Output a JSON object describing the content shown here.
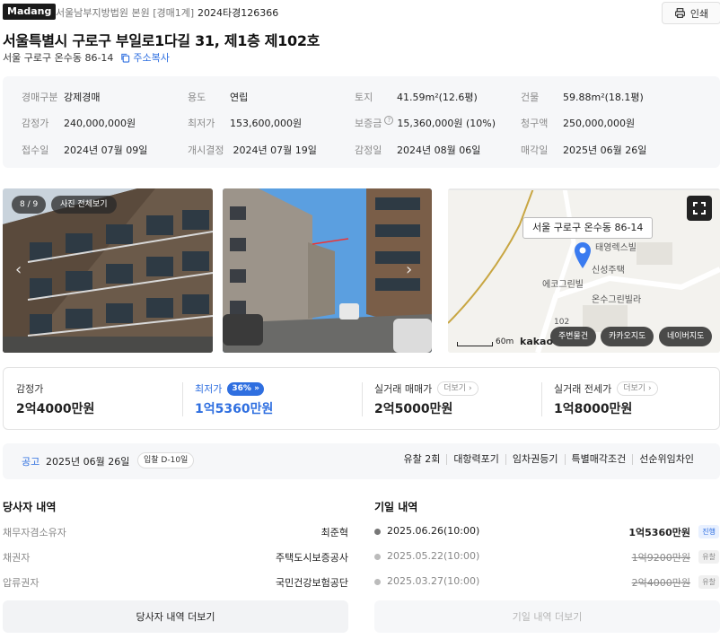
{
  "header": {
    "logo": "Madang",
    "court": "서울남부지방법원 본원 [경매1계]",
    "case_no": "2024타경126366",
    "print_label": "인쇄"
  },
  "property": {
    "title": "서울특별시 구로구 부일로1다길 31, 제1층 제102호",
    "lot_address": "서울 구로구 온수동 86-14",
    "copy_label": "주소복사"
  },
  "info": [
    {
      "key": "경매구분",
      "value": "강제경매"
    },
    {
      "key": "용도",
      "value": "연립"
    },
    {
      "key": "토지",
      "value": "41.59m²(12.6평)"
    },
    {
      "key": "건물",
      "value": "59.88m²(18.1평)"
    },
    {
      "key": "감정가",
      "value": "240,000,000원"
    },
    {
      "key": "최저가",
      "value": "153,600,000원"
    },
    {
      "key": "보증금",
      "value": "15,360,000원 (10%)"
    },
    {
      "key": "청구액",
      "value": "250,000,000원"
    },
    {
      "key": "접수일",
      "value": "2024년 07월 09일"
    },
    {
      "key": "개시결정",
      "value": "2024년 07월 19일"
    },
    {
      "key": "감정일",
      "value": "2024년 08월 06일"
    },
    {
      "key": "매각일",
      "value": "2025년 06월 26일"
    }
  ],
  "gallery": {
    "counter": "8 / 9",
    "view_all": "사진 전체보기"
  },
  "map": {
    "address_label": "서울 구로구 온수동 86-14",
    "places": [
      "태영렉스빌",
      "신성주택",
      "에코그린빌",
      "온수그린빌라",
      "102"
    ],
    "scale": "60m",
    "brand": "kakao",
    "buttons": [
      "주변물건",
      "카카오지도",
      "네이버지도"
    ]
  },
  "prices": {
    "appraisal_label": "감정가",
    "appraisal_value": "2억4000만원",
    "min_label": "최저가",
    "min_pct": "36%",
    "min_value": "1억5360만원",
    "sale_label": "실거래 매매가",
    "sale_value": "2억5000만원",
    "jeonse_label": "실거래 전세가",
    "jeonse_value": "1억8000만원",
    "more_label": "더보기"
  },
  "notice": {
    "label": "공고",
    "date": "2025년 06월 26일",
    "dday": "입찰 D-10일",
    "tags": [
      "유찰 2회",
      "대항력포기",
      "임차권등기",
      "특별매각조건",
      "선순위임차인"
    ]
  },
  "parties": {
    "title": "당사자 내역",
    "rows": [
      {
        "key": "채무자겸소유자",
        "value": "최준혁"
      },
      {
        "key": "채권자",
        "value": "주택도시보증공사"
      },
      {
        "key": "압류권자",
        "value": "국민건강보험공단"
      }
    ],
    "more_label": "당사자 내역 더보기"
  },
  "history": {
    "title": "기일 내역",
    "rows": [
      {
        "date": "2025.06.26(10:00)",
        "amount": "1억5360만원",
        "status": "진행"
      },
      {
        "date": "2025.05.22(10:00)",
        "amount": "1억9200만원",
        "status": "유찰"
      },
      {
        "date": "2025.03.27(10:00)",
        "amount": "2억4000만원",
        "status": "유찰"
      }
    ],
    "more_label": "기일 내역 더보기"
  },
  "colors": {
    "accent": "#2f6fe0",
    "map_pin": "#3a7bf0",
    "status_active_bg": "#e8f0ff",
    "status_failed_bg": "#f0f0f0"
  }
}
